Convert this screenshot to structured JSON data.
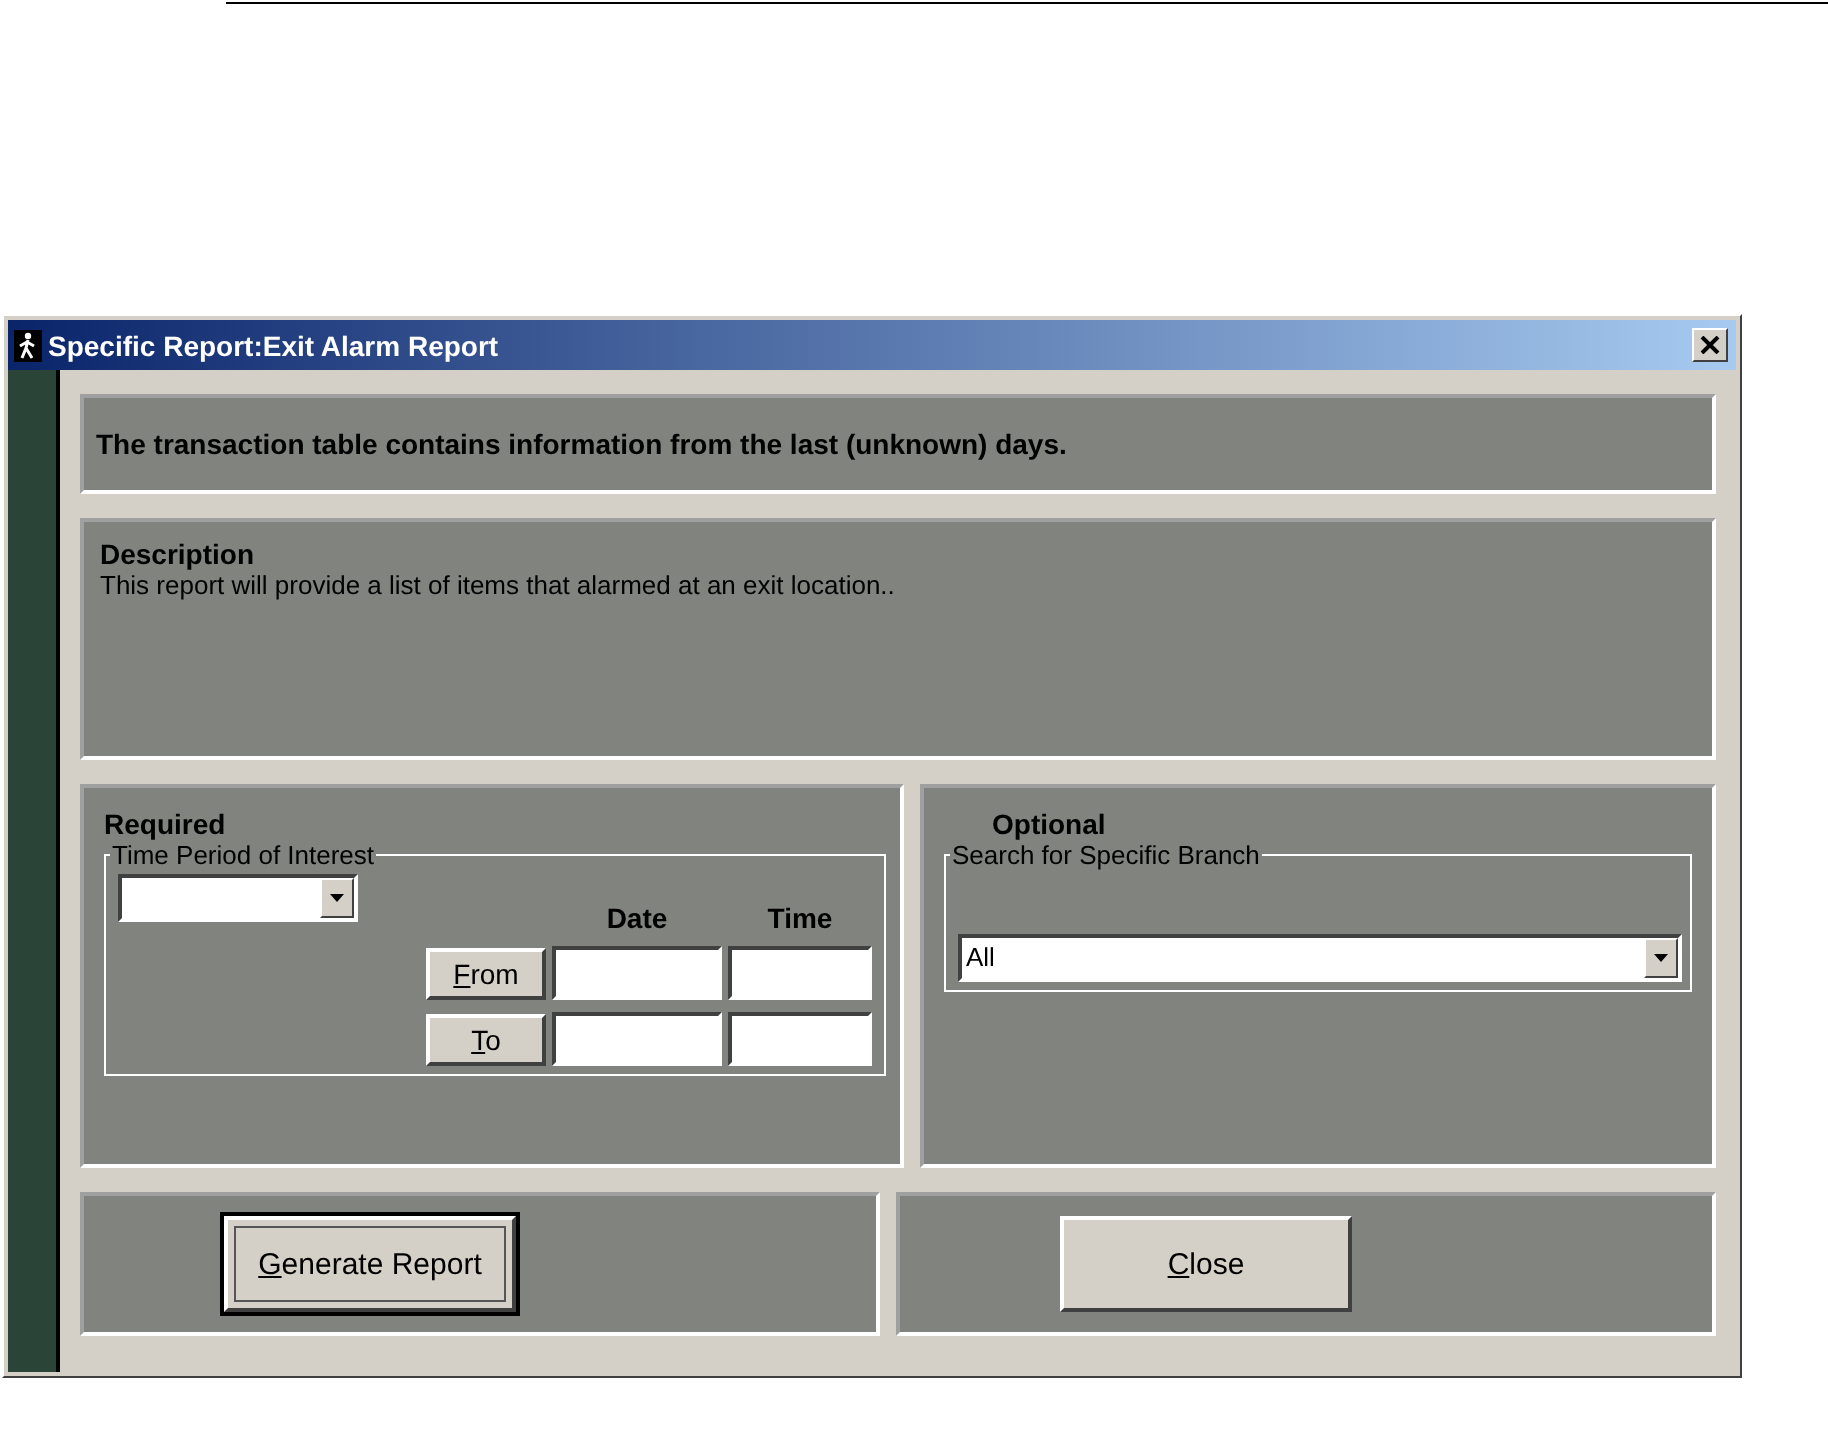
{
  "window": {
    "title": "Specific Report:Exit Alarm Report"
  },
  "info": "The transaction table contains information from the last (unknown) days.",
  "description": {
    "heading": "Description",
    "text": "This report will provide a list of items that alarmed at an exit location.."
  },
  "required": {
    "heading": "Required",
    "group": "Time Period of Interest",
    "columns": [
      "Date",
      "Time"
    ],
    "rows": [
      {
        "button": "From"
      },
      {
        "button": "To"
      }
    ]
  },
  "optional": {
    "heading": "Optional",
    "group": "Search for Specific Branch",
    "branch": "All"
  },
  "buttons": [
    {
      "label": "Generate Report",
      "focused": true
    },
    {
      "label": "Close",
      "focused": false
    }
  ]
}
